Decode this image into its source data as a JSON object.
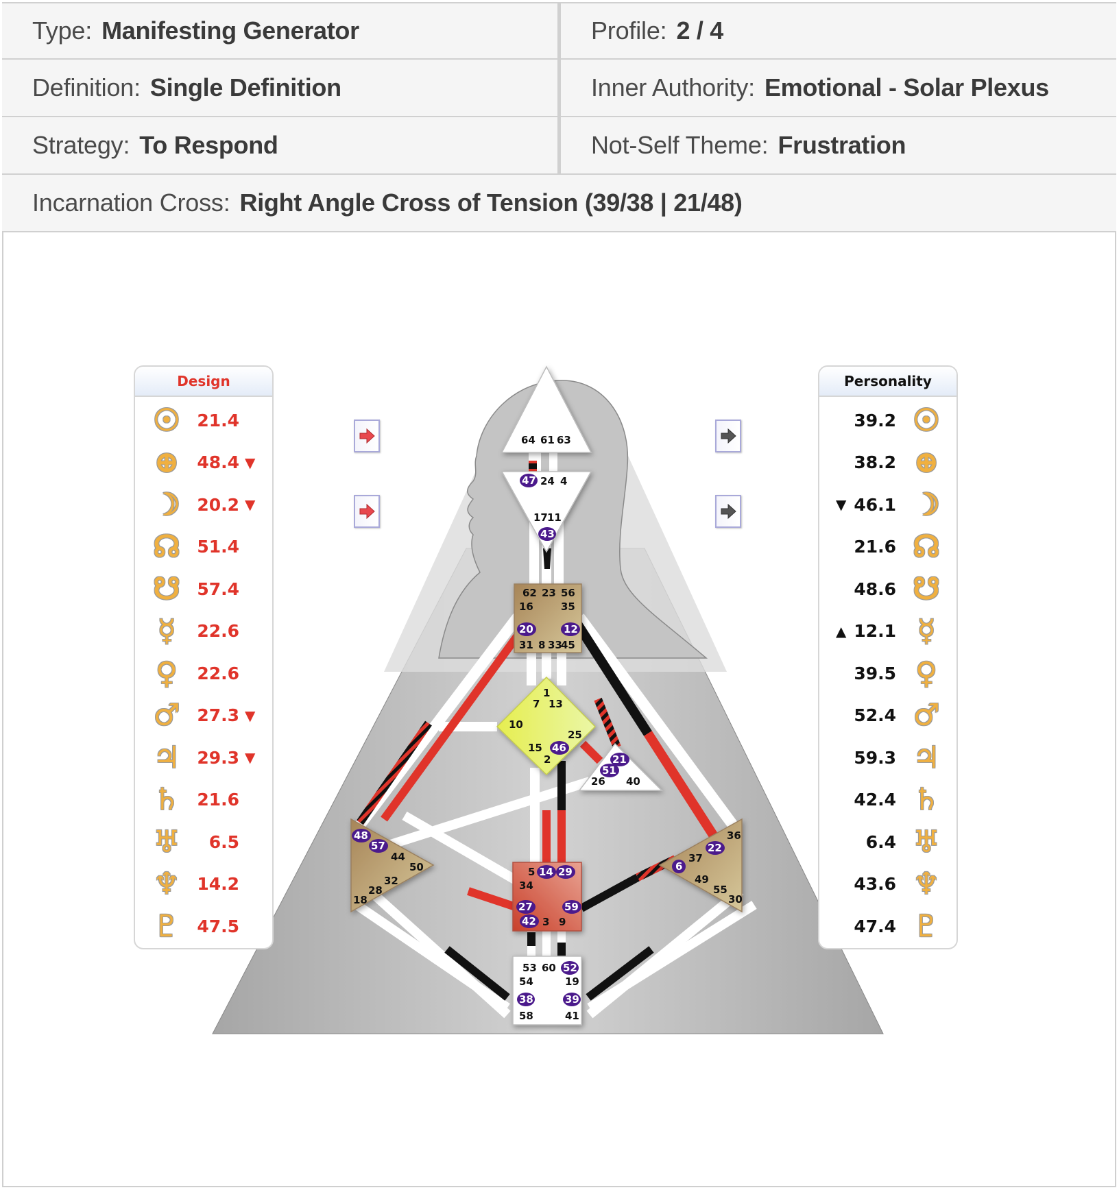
{
  "summary": {
    "type": {
      "label": "Type:",
      "value": "Manifesting Generator"
    },
    "profile": {
      "label": "Profile:",
      "value": "2 / 4"
    },
    "definition": {
      "label": "Definition:",
      "value": "Single Definition"
    },
    "authority": {
      "label": "Inner Authority:",
      "value": "Emotional - Solar Plexus"
    },
    "strategy": {
      "label": "Strategy:",
      "value": "To Respond"
    },
    "not_self": {
      "label": "Not-Self Theme:",
      "value": "Frustration"
    },
    "cross": {
      "label": "Incarnation Cross:",
      "value": "Right Angle Cross of Tension (39/38 | 21/48)"
    }
  },
  "colors": {
    "design": "#e0342a",
    "personality": "#111111",
    "active_gate": "#4b1a8c",
    "head_center": "#ffffff",
    "g_center": "#e6f070",
    "motor_center": "#b8966a",
    "sacral_center": "#d8604a"
  },
  "design": {
    "title": "Design",
    "planets": [
      {
        "icon": "sun-icon",
        "glyph": "☉",
        "value": "21.4",
        "mark": ""
      },
      {
        "icon": "earth-icon",
        "glyph": "⊕",
        "value": "48.4",
        "mark": "▼"
      },
      {
        "icon": "moon-icon",
        "glyph": "☽",
        "value": "20.2",
        "mark": "▼"
      },
      {
        "icon": "north-node-icon",
        "glyph": "☊",
        "value": "51.4",
        "mark": ""
      },
      {
        "icon": "south-node-icon",
        "glyph": "☋",
        "value": "57.4",
        "mark": ""
      },
      {
        "icon": "mercury-icon",
        "glyph": "☿",
        "value": "22.6",
        "mark": ""
      },
      {
        "icon": "venus-icon",
        "glyph": "♀",
        "value": "22.6",
        "mark": ""
      },
      {
        "icon": "mars-icon",
        "glyph": "♂",
        "value": "27.3",
        "mark": "▼"
      },
      {
        "icon": "jupiter-icon",
        "glyph": "♃",
        "value": "29.3",
        "mark": "▼"
      },
      {
        "icon": "saturn-icon",
        "glyph": "♄",
        "value": "21.6",
        "mark": ""
      },
      {
        "icon": "uranus-icon",
        "glyph": "♅",
        "value": "6.5",
        "mark": ""
      },
      {
        "icon": "neptune-icon",
        "glyph": "♆",
        "value": "14.2",
        "mark": ""
      },
      {
        "icon": "pluto-icon",
        "glyph": "♇",
        "value": "47.5",
        "mark": ""
      }
    ]
  },
  "personality": {
    "title": "Personality",
    "planets": [
      {
        "icon": "sun-icon",
        "glyph": "☉",
        "value": "39.2",
        "mark": ""
      },
      {
        "icon": "earth-icon",
        "glyph": "⊕",
        "value": "38.2",
        "mark": ""
      },
      {
        "icon": "moon-icon",
        "glyph": "☽",
        "value": "46.1",
        "mark": "▼"
      },
      {
        "icon": "north-node-icon",
        "glyph": "☊",
        "value": "21.6",
        "mark": ""
      },
      {
        "icon": "south-node-icon",
        "glyph": "☋",
        "value": "48.6",
        "mark": ""
      },
      {
        "icon": "mercury-icon",
        "glyph": "☿",
        "value": "12.1",
        "mark": "▲"
      },
      {
        "icon": "venus-icon",
        "glyph": "♀",
        "value": "39.5",
        "mark": ""
      },
      {
        "icon": "mars-icon",
        "glyph": "♂",
        "value": "52.4",
        "mark": ""
      },
      {
        "icon": "jupiter-icon",
        "glyph": "♃",
        "value": "59.3",
        "mark": ""
      },
      {
        "icon": "saturn-icon",
        "glyph": "♄",
        "value": "42.4",
        "mark": ""
      },
      {
        "icon": "uranus-icon",
        "glyph": "♅",
        "value": "6.4",
        "mark": ""
      },
      {
        "icon": "neptune-icon",
        "glyph": "♆",
        "value": "43.6",
        "mark": ""
      },
      {
        "icon": "pluto-icon",
        "glyph": "♇",
        "value": "47.4",
        "mark": ""
      }
    ]
  },
  "nav_buttons": [
    {
      "name": "design-arrow-button-1",
      "color": "red"
    },
    {
      "name": "design-arrow-button-2",
      "color": "red"
    },
    {
      "name": "personality-arrow-button-1",
      "color": "gray"
    },
    {
      "name": "personality-arrow-button-2",
      "color": "gray"
    }
  ],
  "bodygraph": {
    "centers": {
      "head": {
        "gates": [
          "64",
          "61",
          "63"
        ],
        "active": []
      },
      "ajna": {
        "gates": [
          "47",
          "24",
          "4",
          "17",
          "11",
          "43"
        ],
        "active": [
          "47",
          "43"
        ]
      },
      "throat": {
        "gates": [
          "62",
          "23",
          "56",
          "16",
          "35",
          "20",
          "12",
          "31",
          "8",
          "33",
          "45"
        ],
        "active": [
          "20",
          "12"
        ]
      },
      "g": {
        "gates": [
          "1",
          "7",
          "13",
          "10",
          "25",
          "15",
          "46",
          "2"
        ],
        "active": [
          "46"
        ]
      },
      "ego": {
        "gates": [
          "21",
          "51",
          "26",
          "40"
        ],
        "active": [
          "21",
          "51"
        ]
      },
      "spleen": {
        "gates": [
          "48",
          "57",
          "44",
          "50",
          "32",
          "28",
          "18"
        ],
        "active": [
          "48",
          "57"
        ]
      },
      "solar_plexus": {
        "gates": [
          "36",
          "22",
          "37",
          "6",
          "49",
          "55",
          "30"
        ],
        "active": [
          "22",
          "6"
        ]
      },
      "sacral": {
        "gates": [
          "5",
          "14",
          "29",
          "34",
          "27",
          "59",
          "42",
          "3",
          "9"
        ],
        "active": [
          "14",
          "29",
          "27",
          "59",
          "42"
        ]
      },
      "root": {
        "gates": [
          "53",
          "60",
          "52",
          "54",
          "19",
          "38",
          "39",
          "58",
          "41"
        ],
        "active": [
          "52",
          "38",
          "39"
        ]
      }
    }
  }
}
